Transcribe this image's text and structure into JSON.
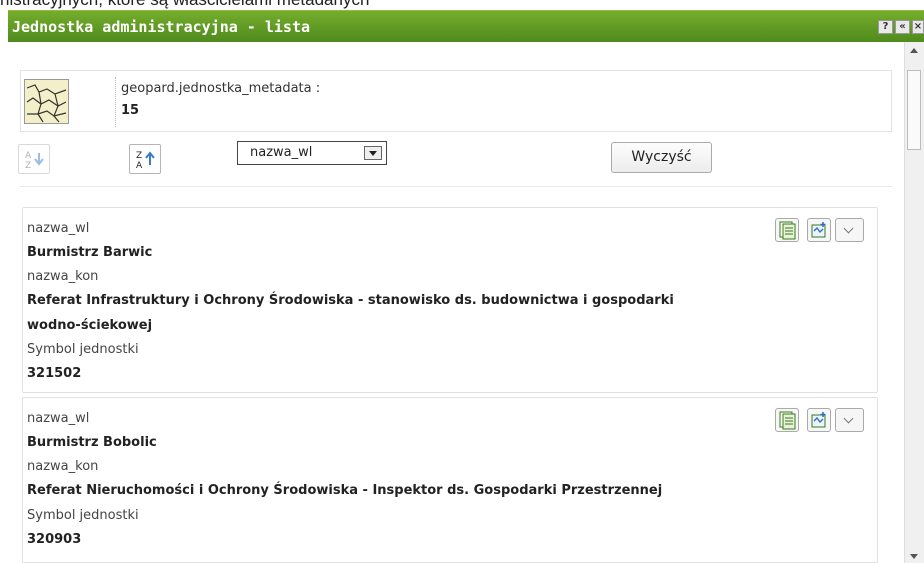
{
  "header": {
    "top_text": "nistracyjnych, które są właścicielami metadanych",
    "title": "Jednostka administracyjna - lista",
    "help_label": "?",
    "collapse_label": "«",
    "close_label": "×"
  },
  "metadata": {
    "name": "geopard.jednostka_metadata :",
    "count": "15"
  },
  "sort": {
    "selected": "nazwa_wl",
    "clear_label": "Wyczyść"
  },
  "records": [
    {
      "field1_label": "nazwa_wl",
      "field1_value": "Burmistrz Barwic",
      "field2_label": "nazwa_kon",
      "field2_value_line1": "Referat Infrastruktury i Ochrony Środowiska - stanowisko ds. budownictwa i gospodarki",
      "field2_value_line2": "wodno-ściekowej",
      "field3_label": "Symbol jednostki",
      "field3_value": "321502"
    },
    {
      "field1_label": "nazwa_wl",
      "field1_value": "Burmistrz Bobolic",
      "field2_label": "nazwa_kon",
      "field2_value_line1": "Referat Nieruchomości i Ochrony Środowiska - Inspektor ds. Gospodarki Przestrzennej",
      "field3_label": "Symbol jednostki",
      "field3_value": "320903"
    }
  ],
  "icons": [
    "help-icon",
    "collapse-icon",
    "close-icon",
    "map-thumbnail",
    "sort-ascending-icon",
    "sort-descending-icon",
    "dropdown-arrow-icon",
    "document-list-icon",
    "map-edit-icon",
    "chevron-down-icon"
  ],
  "colors": {
    "titlebar": "#5e9a23",
    "title_text": "#ffffff"
  }
}
